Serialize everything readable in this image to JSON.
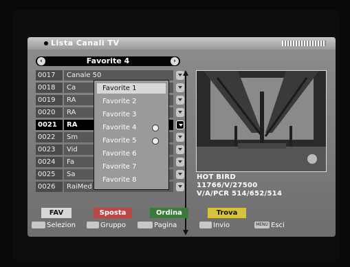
{
  "header": {
    "title": "Lista Canali TV"
  },
  "group": {
    "label": "Favorite 4",
    "left": "‹",
    "right": "›"
  },
  "channels": [
    {
      "num": "0017",
      "name": "Canale 50"
    },
    {
      "num": "0018",
      "name": "Ca"
    },
    {
      "num": "0019",
      "name": "RA"
    },
    {
      "num": "0020",
      "name": "RA"
    },
    {
      "num": "0021",
      "name": "RA"
    },
    {
      "num": "0022",
      "name": "Sm"
    },
    {
      "num": "0023",
      "name": "Vid"
    },
    {
      "num": "0024",
      "name": "Fa"
    },
    {
      "num": "0025",
      "name": "Sa"
    },
    {
      "num": "0026",
      "name": "RaiMed"
    }
  ],
  "popup": {
    "items": [
      "Favorite 1",
      "Favorite 2",
      "Favorite 3",
      "Favorite 4",
      "Favorite 5",
      "Favorite 6",
      "Favorite 7",
      "Favorite 8"
    ]
  },
  "info": {
    "satellite": "HOT BIRD",
    "transponder": "11766/V/27500",
    "pids": "V/A/PCR 514/652/514"
  },
  "buttons": {
    "fav": "FAV",
    "move": "Sposta",
    "order": "Ordina",
    "find": "Trova"
  },
  "hints": {
    "select": "Selezion",
    "group": "Gruppo",
    "page": "Pagina",
    "send": "Invio",
    "exit": "Esci",
    "menu_key": "MENU"
  },
  "colors": {
    "fav": "#d8d8d8",
    "move": "#b84848",
    "order": "#3c7a3c",
    "find": "#d6c23c"
  }
}
